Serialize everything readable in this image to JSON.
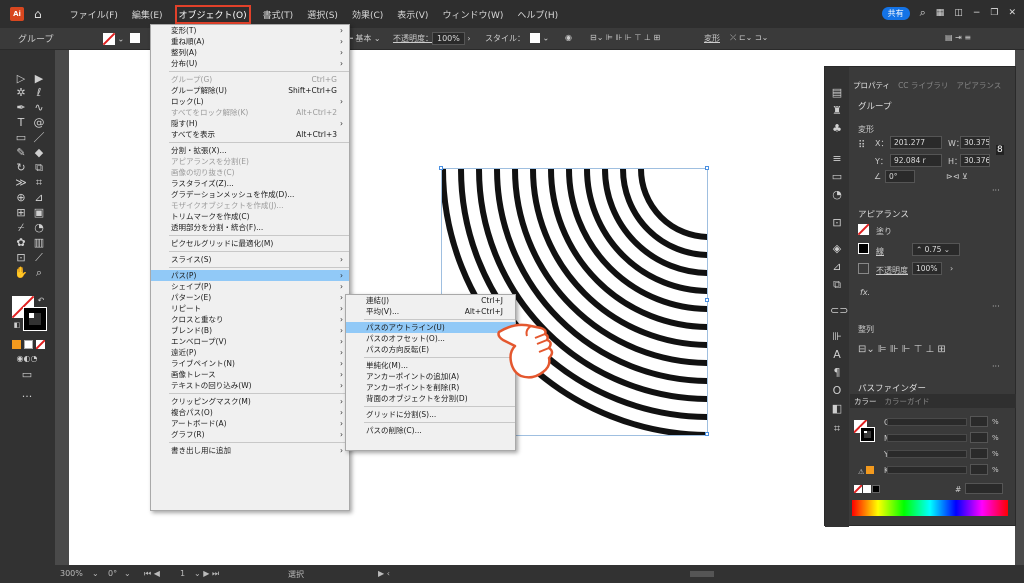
{
  "menubar": {
    "app_logo": "Ai",
    "items": [
      "ファイル(F)",
      "編集(E)",
      "オブジェクト(O)",
      "書式(T)",
      "選択(S)",
      "効果(C)",
      "表示(V)",
      "ウィンドウ(W)",
      "ヘルプ(H)"
    ],
    "active_index": 2,
    "share_label": "共有"
  },
  "control_bar": {
    "selection_label": "グループ",
    "stroke_style": "基本",
    "opacity_label": "不透明度：",
    "opacity_value": "100%",
    "style_label": "スタイル：",
    "align_label": "整列",
    "transform_label": "変形"
  },
  "object_menu": {
    "items": [
      {
        "label": "変形(T)",
        "arrow": true
      },
      {
        "label": "重ね順(A)",
        "arrow": true
      },
      {
        "label": "整列(A)",
        "arrow": true
      },
      {
        "label": "分布(U)",
        "arrow": true
      },
      {
        "sep": true
      },
      {
        "label": "グループ(G)",
        "shortcut": "Ctrl+G",
        "disabled": true
      },
      {
        "label": "グループ解除(U)",
        "shortcut": "Shift+Ctrl+G"
      },
      {
        "label": "ロック(L)",
        "arrow": true
      },
      {
        "label": "すべてをロック解除(K)",
        "shortcut": "Alt+Ctrl+2",
        "disabled": true
      },
      {
        "label": "隠す(H)",
        "arrow": true
      },
      {
        "label": "すべてを表示",
        "shortcut": "Alt+Ctrl+3"
      },
      {
        "sep": true
      },
      {
        "label": "分割・拡張(X)..."
      },
      {
        "label": "アピアランスを分割(E)",
        "disabled": true
      },
      {
        "label": "画像の切り抜き(C)",
        "disabled": true
      },
      {
        "label": "ラスタライズ(Z)..."
      },
      {
        "label": "グラデーションメッシュを作成(D)..."
      },
      {
        "label": "モザイクオブジェクトを作成(J)...",
        "disabled": true
      },
      {
        "label": "トリムマークを作成(C)"
      },
      {
        "label": "透明部分を分割・統合(F)..."
      },
      {
        "sep": true
      },
      {
        "label": "ピクセルグリッドに最適化(M)"
      },
      {
        "sep": true
      },
      {
        "label": "スライス(S)",
        "arrow": true
      },
      {
        "sep": true
      },
      {
        "label": "パス(P)",
        "arrow": true,
        "highlight": true
      },
      {
        "label": "シェイプ(P)",
        "arrow": true
      },
      {
        "label": "パターン(E)",
        "arrow": true
      },
      {
        "label": "リピート",
        "arrow": true
      },
      {
        "label": "クロスと重なり",
        "arrow": true
      },
      {
        "label": "ブレンド(B)",
        "arrow": true
      },
      {
        "label": "エンベロープ(V)",
        "arrow": true
      },
      {
        "label": "遠近(P)",
        "arrow": true
      },
      {
        "label": "ライブペイント(N)",
        "arrow": true
      },
      {
        "label": "画像トレース",
        "arrow": true
      },
      {
        "label": "テキストの回り込み(W)",
        "arrow": true
      },
      {
        "sep": true
      },
      {
        "label": "クリッピングマスク(M)",
        "arrow": true
      },
      {
        "label": "複合パス(O)",
        "arrow": true
      },
      {
        "label": "アートボード(A)",
        "arrow": true
      },
      {
        "label": "グラフ(R)",
        "arrow": true
      },
      {
        "sep": true
      },
      {
        "label": "書き出し用に追加",
        "arrow": true
      }
    ]
  },
  "path_menu": {
    "items": [
      {
        "label": "連結(J)",
        "shortcut": "Ctrl+J"
      },
      {
        "label": "平均(V)...",
        "shortcut": "Alt+Ctrl+J"
      },
      {
        "sep": true
      },
      {
        "label": "パスのアウトライン(U)",
        "highlight": true
      },
      {
        "label": "パスのオフセット(O)..."
      },
      {
        "label": "パスの方向反転(E)"
      },
      {
        "sep": true
      },
      {
        "label": "単純化(M)..."
      },
      {
        "label": "アンカーポイントの追加(A)"
      },
      {
        "label": "アンカーポイントを削除(R)"
      },
      {
        "label": "背面のオブジェクトを分割(D)"
      },
      {
        "sep": true
      },
      {
        "label": "グリッドに分割(S)..."
      },
      {
        "sep": true
      },
      {
        "label": "パスの削除(C)..."
      }
    ]
  },
  "right_panel": {
    "tabs": [
      "プロパティ",
      "CC ライブラリ",
      "アピアランス"
    ],
    "active_tab": 0,
    "selection": "グループ",
    "transform_title": "変形",
    "x_label": "X：",
    "x_value": "201.277",
    "y_label": "Y：",
    "y_value": "92.084 r",
    "w_label": "W：",
    "w_value": "30.375 r",
    "h_label": "H：",
    "h_value": "30.376 r",
    "angle_value": "0°",
    "appearance_title": "アピアランス",
    "fill_label": "塗り",
    "stroke_label": "線",
    "stroke_weight": "0.75",
    "opacity_label": "不透明度",
    "opacity_value": "100%",
    "fx_label": "fx.",
    "align_title": "整列",
    "pathfinder_title": "パスファインダー",
    "color_tabs": [
      "カラー",
      "カラーガイド"
    ],
    "cmyk_labels": [
      "C",
      "M",
      "Y",
      "K"
    ],
    "percent_sign": "%",
    "hash_sign": "#"
  },
  "status_bar": {
    "zoom": "300%",
    "rotation": "0°",
    "artboard_num": "1",
    "tool_name": "選択"
  }
}
